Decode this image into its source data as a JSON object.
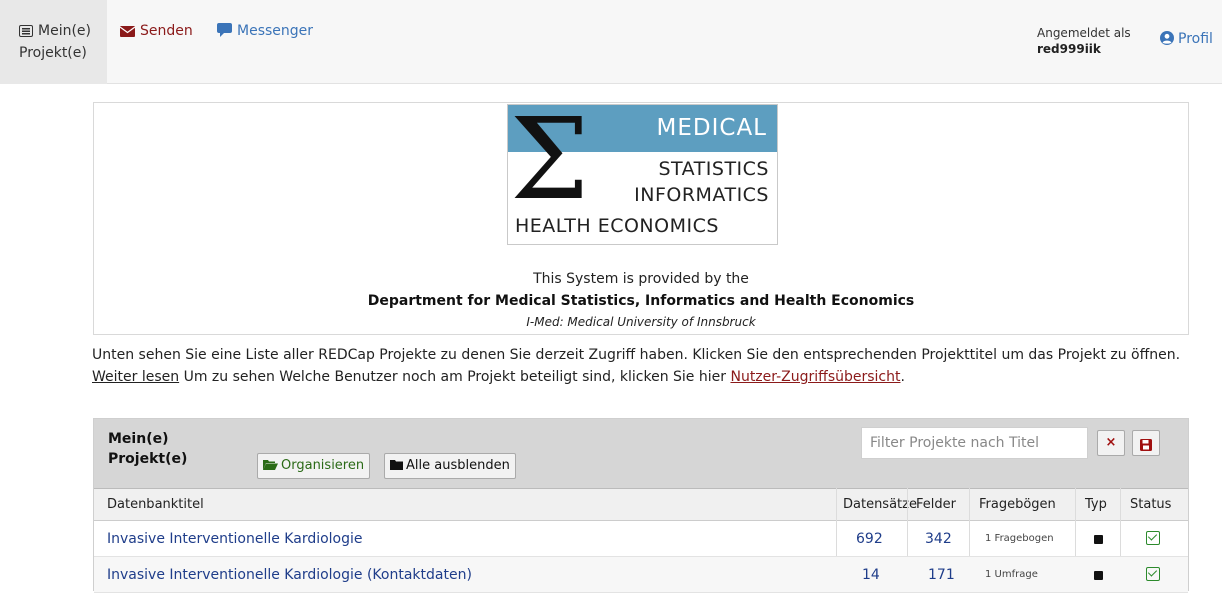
{
  "nav": {
    "projects_label_1": "Mein(e)",
    "projects_label_2": "Projekt(e)",
    "send_label": "Senden",
    "messenger_label": "Messenger",
    "login_label": "Angemeldet als",
    "login_user": "red999iik",
    "profile_label": "Profil"
  },
  "logo": {
    "medical": "MEDICAL",
    "line1": "STATISTICS",
    "line2": "INFORMATICS",
    "line3": "HEALTH ECONOMICS",
    "sigma": "Σ"
  },
  "card": {
    "line1": "This System is provided by the",
    "line2": "Department for Medical Statistics, Informatics and Health Economics",
    "line3": "I-Med: Medical University of Innsbruck"
  },
  "intro": {
    "text1": "Unten sehen Sie eine Liste aller REDCap Projekte zu denen Sie derzeit Zugriff haben. Klicken Sie den entsprechenden Projekttitel um das Projekt zu öffnen. ",
    "read_more": "Weiter lesen",
    "text2": " Um zu sehen Welche Benutzer noch am Projekt beteiligt sind, klicken Sie hier ",
    "access_link": "Nutzer-Zugriffsübersicht",
    "text3": "."
  },
  "panel": {
    "title_1": "Mein(e)",
    "title_2": "Projekt(e)",
    "organize_label": "Organisieren",
    "hide_all_label": "Alle ausblenden",
    "filter_placeholder": "Filter Projekte nach Titel",
    "clear_label": "×"
  },
  "table": {
    "headers": {
      "title": "Datenbanktitel",
      "records": "Datensätze",
      "fields": "Felder",
      "forms": "Fragebögen",
      "type": "Typ",
      "status": "Status"
    },
    "rows": [
      {
        "title": "Invasive Interventionelle Kardiologie",
        "records": "692",
        "fields": "342",
        "forms": "1 Fragebogen"
      },
      {
        "title": "Invasive Interventionelle Kardiologie (Kontaktdaten)",
        "records": "14",
        "fields": "171",
        "forms": "1 Umfrage"
      }
    ]
  },
  "colors": {
    "accent_red": "#8b1a1a",
    "link_blue": "#1f3d8a",
    "messenger_blue": "#3b74b8",
    "logo_blue": "#5d9ec0",
    "status_green": "#2c8a2c"
  }
}
